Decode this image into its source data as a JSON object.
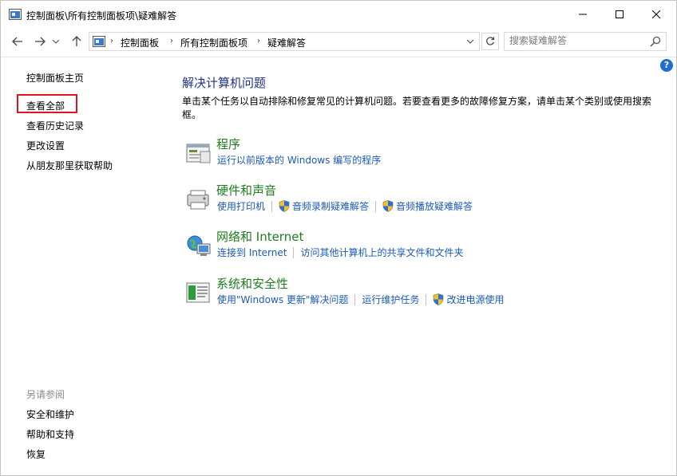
{
  "window": {
    "title": "控制面板\\所有控制面板项\\疑难解答"
  },
  "address_bar": {
    "crumbs": [
      "控制面板",
      "所有控制面板项",
      "疑难解答"
    ]
  },
  "search": {
    "placeholder": "搜索疑难解答"
  },
  "left_pane": {
    "home": "控制面板主页",
    "view_all": "查看全部",
    "view_history": "查看历史记录",
    "change_settings": "更改设置",
    "get_help_from_friend": "从朋友那里获取帮助",
    "see_also_label": "另请参阅",
    "see_also": [
      "安全和维护",
      "帮助和支持",
      "恢复"
    ]
  },
  "main": {
    "title": "解决计算机问题",
    "description": "单击某个任务以自动排除和修复常见的计算机问题。若要查看更多的故障修复方案，请单击某个类别或使用搜索框。",
    "categories": [
      {
        "title": "程序",
        "icon": "programs-icon",
        "links": [
          "运行以前版本的 Windows 编写的程序"
        ]
      },
      {
        "title": "硬件和声音",
        "icon": "hardware-sound-icon",
        "links": [
          "使用打印机",
          "音频录制疑难解答",
          "音频播放疑难解答"
        ]
      },
      {
        "title": "网络和 Internet",
        "icon": "network-icon",
        "links": [
          "连接到 Internet",
          "访问其他计算机上的共享文件和文件夹"
        ]
      },
      {
        "title": "系统和安全性",
        "icon": "system-security-icon",
        "links": [
          "使用\"Windows 更新\"解决问题",
          "运行维护任务",
          "改进电源使用"
        ]
      }
    ]
  },
  "colors": {
    "link_blue": "#1a5bb8",
    "category_green": "#1e7d1e",
    "title_blue": "#1e3287",
    "highlight_red": "#e0141e"
  }
}
